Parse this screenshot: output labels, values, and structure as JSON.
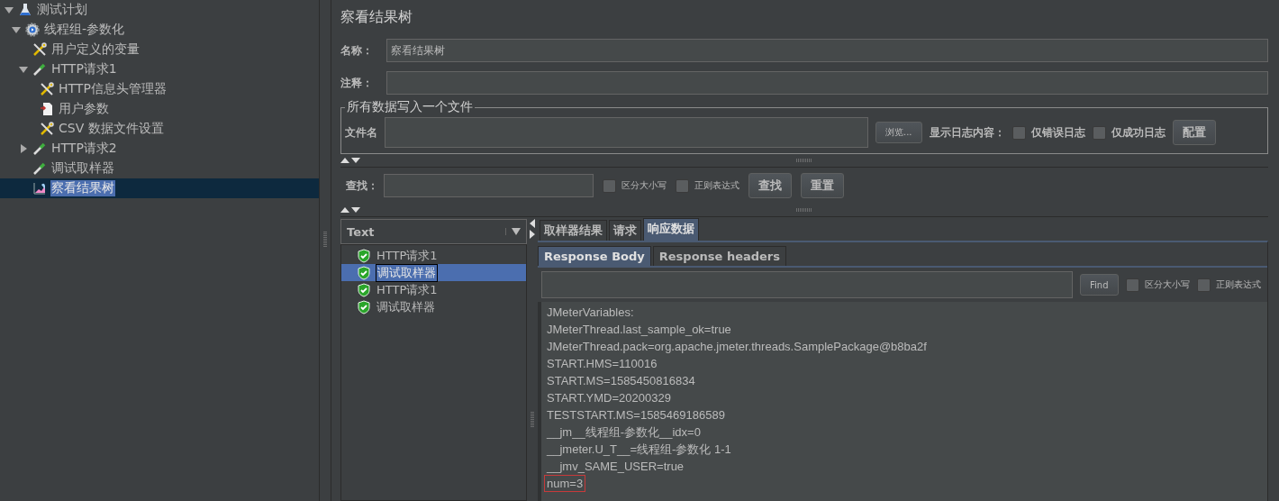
{
  "tree": [
    {
      "label": "测试计划",
      "kind": "flask",
      "expanded": true,
      "selected": false,
      "children": [
        {
          "label": "线程组-参数化",
          "kind": "gear",
          "expanded": true,
          "selected": false,
          "children": [
            {
              "label": "用户定义的变量",
              "kind": "wrench",
              "selected": false
            },
            {
              "label": "HTTP请求1",
              "kind": "pipette",
              "expanded": true,
              "selected": false,
              "children": [
                {
                  "label": "HTTP信息头管理器",
                  "kind": "wrench",
                  "selected": false
                },
                {
                  "label": "用户参数",
                  "kind": "document",
                  "selected": false
                },
                {
                  "label": "CSV 数据文件设置",
                  "kind": "wrench",
                  "selected": false
                }
              ]
            },
            {
              "label": "HTTP请求2",
              "kind": "pipette",
              "expanded": false,
              "selected": false
            },
            {
              "label": "调试取样器",
              "kind": "pipette",
              "selected": false
            },
            {
              "label": "察看结果树",
              "kind": "graph",
              "selected": true
            }
          ]
        }
      ]
    }
  ],
  "panel": {
    "title": "察看结果树",
    "name_label": "名称：",
    "name_value": "察看结果树",
    "comment_label": "注释：",
    "file_group": {
      "legend": "所有数据写入一个文件",
      "file_label": "文件名",
      "browse": "浏览...",
      "log_label": "显示日志内容：",
      "checks": [
        {
          "label": "仅错误日志",
          "checked": false
        },
        {
          "label": "仅成功日志",
          "checked": false
        }
      ],
      "config": "配置"
    },
    "search": {
      "label": "查找：",
      "checks": [
        {
          "label": "区分大小写",
          "checked": false
        },
        {
          "label": "正则表达式",
          "checked": false
        }
      ],
      "find": "查找",
      "reset": "重置"
    }
  },
  "results": {
    "renderer": "Text",
    "samples": [
      {
        "label": "HTTP请求1",
        "selected": false
      },
      {
        "label": "调试取样器",
        "selected": true
      },
      {
        "label": "HTTP请求1",
        "selected": false
      },
      {
        "label": "调试取样器",
        "selected": false
      }
    ],
    "tabs": [
      {
        "label": "取样器结果",
        "selected": false
      },
      {
        "label": "请求",
        "selected": false
      },
      {
        "label": "响应数据",
        "selected": true
      }
    ],
    "subtabs": [
      {
        "label": "Response Body",
        "selected": true
      },
      {
        "label": "Response headers",
        "selected": false
      }
    ],
    "find_button": "Find",
    "find_checks": [
      {
        "label": "区分大小写",
        "checked": false
      },
      {
        "label": "正则表达式",
        "checked": false
      }
    ],
    "lines": [
      {
        "text": "JMeterVariables:",
        "highlighted": false
      },
      {
        "text": "JMeterThread.last_sample_ok=true",
        "highlighted": false
      },
      {
        "text": "JMeterThread.pack=org.apache.jmeter.threads.SamplePackage@b8ba2f",
        "highlighted": false
      },
      {
        "text": "START.HMS=110016",
        "highlighted": false
      },
      {
        "text": "START.MS=1585450816834",
        "highlighted": false
      },
      {
        "text": "START.YMD=20200329",
        "highlighted": false
      },
      {
        "text": "TESTSTART.MS=1585469186589",
        "highlighted": false
      },
      {
        "text": "__jm__线程组-参数化__idx=0",
        "highlighted": false
      },
      {
        "text": "__jmeter.U_T__=线程组-参数化 1-1",
        "highlighted": false
      },
      {
        "text": "__jmv_SAME_USER=true",
        "highlighted": false
      },
      {
        "text": "num=3",
        "highlighted": true
      }
    ]
  }
}
